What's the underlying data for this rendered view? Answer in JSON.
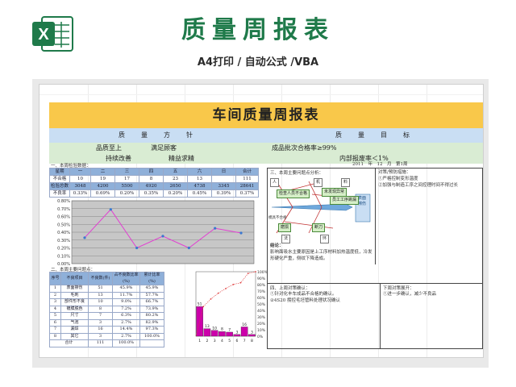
{
  "header": {
    "title": "质量周报表",
    "subtitle": "A4打印 / 自动公式 /VBA"
  },
  "sheet": {
    "title": "车间质量周报表",
    "policy_head": "质　量　方　针",
    "goal_head": "质　量　目　标",
    "policy_lines": [
      "品质至上",
      "满足顾客",
      "持续改善",
      "精益求精"
    ],
    "goal_lines": [
      "成品批次合格率≥99%",
      "内部报废率＜1%"
    ],
    "date_line": "2011　年　12　月　第1周",
    "sec1": {
      "label": "一、本周检验数据：",
      "rows": [
        [
          "星期",
          "一",
          "二",
          "三",
          "四",
          "五",
          "六",
          "日",
          "合计"
        ],
        [
          "不合格",
          "10",
          "19",
          "17",
          "8",
          "23",
          "13",
          "111"
        ],
        [
          "检验总数",
          "3048",
          "4200",
          "5500",
          "4920",
          "2650",
          "4738",
          "3345",
          "28641"
        ],
        [
          "不良率",
          "0.33%",
          "0.69%",
          "0.20%",
          "0.35%",
          "0.20%",
          "0.45%",
          "0.39%",
          "0.37%"
        ]
      ],
      "y_ticks": [
        "0.80%",
        "0.70%",
        "0.60%",
        "0.50%",
        "0.40%",
        "0.30%",
        "0.20%",
        "0.10%",
        "0.00%"
      ]
    },
    "sec2": {
      "label": "二、本周主要问题点：",
      "headers": [
        "序号",
        "不良项目",
        "不良数(件)",
        "占不良数比率(%)",
        "累计比率(%)"
      ],
      "rows": [
        [
          "1",
          "表面擦伤",
          "51",
          "45.9%",
          "45.9%"
        ],
        [
          "2",
          "毛刺",
          "13",
          "11.7%",
          "57.7%"
        ],
        [
          "3",
          "部件形不良",
          "10",
          "9.0%",
          "66.7%"
        ],
        [
          "4",
          "镀膜脱色",
          "8",
          "7.2%",
          "73.9%"
        ],
        [
          "5",
          "尺寸",
          "7",
          "6.3%",
          "80.2%"
        ],
        [
          "6",
          "气泡",
          "3",
          "2.7%",
          "82.9%"
        ],
        [
          "7",
          "漏焊",
          "16",
          "14.4%",
          "97.3%"
        ],
        [
          "8",
          "其它",
          "3",
          "2.7%",
          "100.0%"
        ]
      ],
      "total": [
        "合计",
        "111",
        "100.0%"
      ],
      "pct_ticks": [
        "100%",
        "90%",
        "80%",
        "70%",
        "60%",
        "50%",
        "40%",
        "30%",
        "20%",
        "10%",
        "0%"
      ]
    },
    "sec3": {
      "label": "三、本周主要问题点分析：",
      "chips": [
        "人",
        "机",
        "料",
        "未经检验过滤",
        "检查人员不合格",
        "员工工序跳漏",
        "未发现异常",
        "模具不合格",
        "磨损",
        "断刀",
        "来料不良",
        "毛刺",
        "法",
        "环"
      ],
      "fish_head": "表面擦伤",
      "conclusion_head": "结论：",
      "conclusion": "影响面吸水主要原因是上工序材料加热温度低，冷发形硬化严重，侧纹下降造成。",
      "measure_head": "对策/预防措施：",
      "measures": [
        "①严格控制变形温度",
        "②加强与制造工序之间控理时间不得过长"
      ]
    },
    "sec4": {
      "label": "四、上周对策确认：",
      "items": [
        "①针对化丰车成品不合格的确认。",
        "②4S20 攒控毛坯管料处理状况确认"
      ]
    },
    "sec5": {
      "label": "下周对策展开：",
      "items": [
        "①进一步确认，减少不良品"
      ]
    }
  },
  "chart_data": [
    {
      "type": "line",
      "title": "",
      "categories": [
        "一",
        "二",
        "三",
        "四",
        "五",
        "六",
        "日"
      ],
      "series": [
        {
          "values": [
            0.33,
            0.69,
            0.2,
            0.35,
            0.2,
            0.45,
            0.39
          ]
        }
      ],
      "ylim": [
        0,
        0.8
      ],
      "ylabel": "",
      "grid": true
    },
    {
      "type": "bar",
      "categories": [
        "1",
        "2",
        "3",
        "4",
        "5",
        "6",
        "7",
        "8"
      ],
      "values": [
        51,
        13,
        10,
        8,
        7,
        3,
        16,
        3
      ],
      "cumulative_pct": [
        45.9,
        57.7,
        66.7,
        73.9,
        80.2,
        82.9,
        97.3,
        100.0
      ],
      "ylim": [
        0,
        111
      ]
    }
  ],
  "colors": {
    "brand_green": "#1f7a4a",
    "title_band": "#f9c84a",
    "head_blue": "#c9def3",
    "head_green": "#d9ecd3",
    "line": "#e23fd2",
    "bar": "#cc00aa"
  },
  "icons": {
    "logo": "excel-logo-icon"
  }
}
